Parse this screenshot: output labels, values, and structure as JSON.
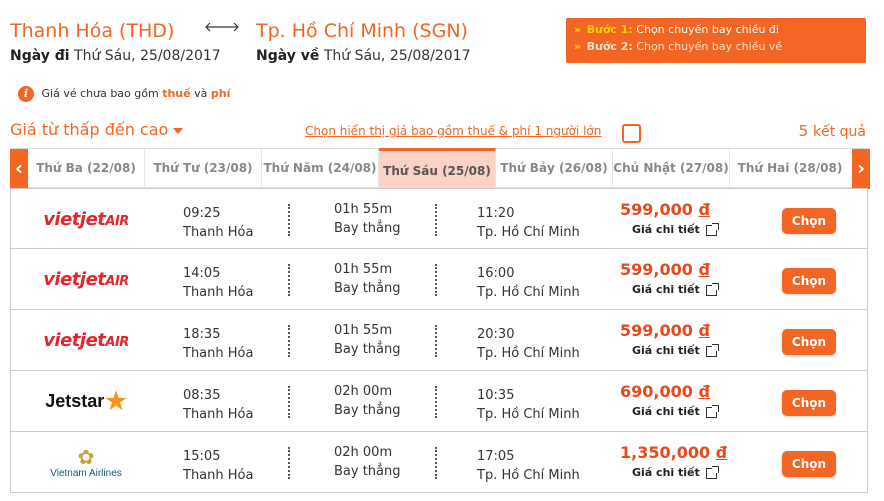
{
  "trip": {
    "origin": "Thanh Hóa (THD)",
    "destination": "Tp. Hồ Chí Minh (SGN)",
    "depart_label": "Ngày đi",
    "depart_date": "Thứ Sáu, 25/08/2017",
    "return_label": "Ngày về",
    "return_date": "Thứ Sáu, 25/08/2017"
  },
  "steps": {
    "step1_label": "Bước 1:",
    "step1_text": "Chọn chuyến bay chiều đi",
    "step2_label": "Bước 2:",
    "step2_text": "Chọn chuyến bay chiều về"
  },
  "notice": {
    "prefix": "Giá vé chưa bao gồm",
    "tax": "thuế",
    "and": "và",
    "fee": "phí"
  },
  "sort": {
    "label": "Giá từ thấp đến cao"
  },
  "tax_toggle": {
    "label": "Chọn hiển thị giá bao gồm thuế & phí 1 người lớn"
  },
  "results": {
    "count": "5",
    "word": "kết quả"
  },
  "datebar": {
    "tabs": [
      "Thứ Ba (22/08)",
      "Thứ Tư (23/08)",
      "Thứ Năm (24/08)",
      "Thứ Sáu (25/08)",
      "Thứ Bảy (26/08)",
      "Chủ Nhật (27/08)",
      "Thứ Hai (28/08)"
    ],
    "active_index": 3
  },
  "flights": [
    {
      "airline": "vietjet",
      "airline_text": "vietjetAir",
      "dep_time": "09:25",
      "dep_city": "Thanh Hóa",
      "duration": "01h 55m",
      "stops": "Bay thẳng",
      "arr_time": "11:20",
      "arr_city": "Tp. Hồ Chí Minh",
      "price": "599,000",
      "currency": "đ",
      "detail": "Giá chi tiết",
      "button": "Chọn"
    },
    {
      "airline": "vietjet",
      "airline_text": "vietjetAir",
      "dep_time": "14:05",
      "dep_city": "Thanh Hóa",
      "duration": "01h 55m",
      "stops": "Bay thẳng",
      "arr_time": "16:00",
      "arr_city": "Tp. Hồ Chí Minh",
      "price": "599,000",
      "currency": "đ",
      "detail": "Giá chi tiết",
      "button": "Chọn"
    },
    {
      "airline": "vietjet",
      "airline_text": "vietjetAir",
      "dep_time": "18:35",
      "dep_city": "Thanh Hóa",
      "duration": "01h 55m",
      "stops": "Bay thẳng",
      "arr_time": "20:30",
      "arr_city": "Tp. Hồ Chí Minh",
      "price": "599,000",
      "currency": "đ",
      "detail": "Giá chi tiết",
      "button": "Chọn"
    },
    {
      "airline": "jetstar",
      "airline_text": "Jetstar",
      "dep_time": "08:35",
      "dep_city": "Thanh Hóa",
      "duration": "02h 00m",
      "stops": "Bay thẳng",
      "arr_time": "10:35",
      "arr_city": "Tp. Hồ Chí Minh",
      "price": "690,000",
      "currency": "đ",
      "detail": "Giá chi tiết",
      "button": "Chọn"
    },
    {
      "airline": "vietnam-airlines",
      "airline_text": "Vietnam Airlines",
      "dep_time": "15:05",
      "dep_city": "Thanh Hóa",
      "duration": "02h 00m",
      "stops": "Bay thẳng",
      "arr_time": "17:05",
      "arr_city": "Tp. Hồ Chí Minh",
      "price": "1,350,000",
      "currency": "đ",
      "detail": "Giá chi tiết",
      "button": "Chọn"
    }
  ],
  "colors": {
    "accent": "#f26522",
    "step_highlight": "#ffd200",
    "active_tab": "#fbd2c3"
  }
}
